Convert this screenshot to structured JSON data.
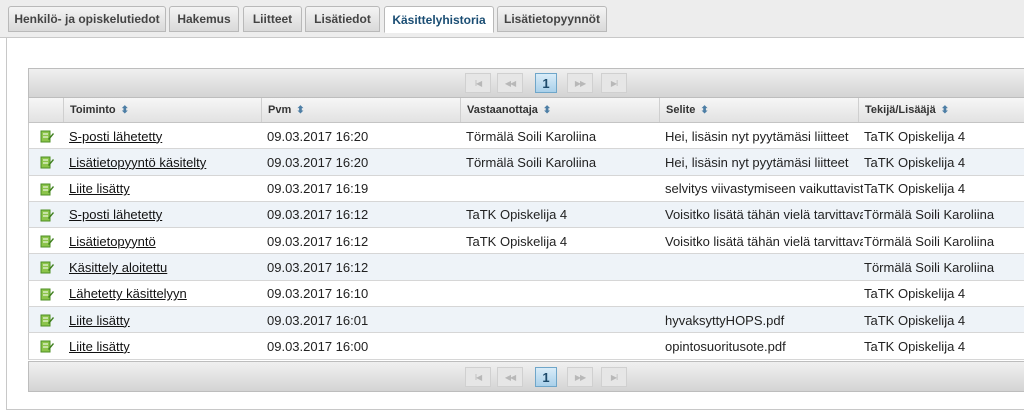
{
  "tabs": [
    {
      "label": "Henkilö- ja opiskelutiedot"
    },
    {
      "label": "Hakemus"
    },
    {
      "label": "Liitteet"
    },
    {
      "label": "Lisätiedot"
    },
    {
      "label": "Käsittelyhistoria"
    },
    {
      "label": "Lisätietopyynnöt"
    }
  ],
  "pager": {
    "first": "I◀",
    "prev": "◀◀",
    "page": "1",
    "next": "▶▶",
    "last": "▶I"
  },
  "columns": [
    {
      "label": "Toiminto"
    },
    {
      "label": "Pvm"
    },
    {
      "label": "Vastaanottaja"
    },
    {
      "label": "Selite"
    },
    {
      "label": "Tekijä/Lisääjä"
    }
  ],
  "rows": [
    {
      "action": "S-posti lähetetty",
      "date": "09.03.2017 16:20",
      "recipient": "Törmälä Soili Karoliina",
      "note": "Hei, lisäsin nyt pyytämäsi liitteet",
      "author": "TaTK Opiskelija 4"
    },
    {
      "action": "Lisätietopyyntö käsitelty",
      "date": "09.03.2017 16:20",
      "recipient": "Törmälä Soili Karoliina",
      "note": "Hei, lisäsin nyt pyytämäsi liitteet",
      "author": "TaTK Opiskelija 4"
    },
    {
      "action": "Liite lisätty",
      "date": "09.03.2017 16:19",
      "recipient": "",
      "note": "selvitys viivastymiseen vaikuttavista",
      "author": "TaTK Opiskelija 4"
    },
    {
      "action": "S-posti lähetetty",
      "date": "09.03.2017 16:12",
      "recipient": "TaTK Opiskelija 4",
      "note": "Voisitko lisätä tähän vielä tarvittavat",
      "author": "Törmälä Soili Karoliina"
    },
    {
      "action": "Lisätietopyyntö",
      "date": "09.03.2017 16:12",
      "recipient": "TaTK Opiskelija 4",
      "note": "Voisitko lisätä tähän vielä tarvittavat",
      "author": "Törmälä Soili Karoliina"
    },
    {
      "action": "Käsittely aloitettu",
      "date": "09.03.2017 16:12",
      "recipient": "",
      "note": "",
      "author": "Törmälä Soili Karoliina"
    },
    {
      "action": "Lähetetty käsittelyyn",
      "date": "09.03.2017 16:10",
      "recipient": "",
      "note": "",
      "author": "TaTK Opiskelija 4"
    },
    {
      "action": "Liite lisätty",
      "date": "09.03.2017 16:01",
      "recipient": "",
      "note": "hyvaksyttyHOPS.pdf",
      "author": "TaTK Opiskelija 4"
    },
    {
      "action": "Liite lisätty",
      "date": "09.03.2017 16:00",
      "recipient": "",
      "note": "opintosuoritusote.pdf",
      "author": "TaTK Opiskelija 4"
    }
  ],
  "icon": "edit-document-icon",
  "colors": {
    "accent": "#1a4d73",
    "row_alt": "#eef3f8",
    "icon_green": "#5aa832"
  }
}
